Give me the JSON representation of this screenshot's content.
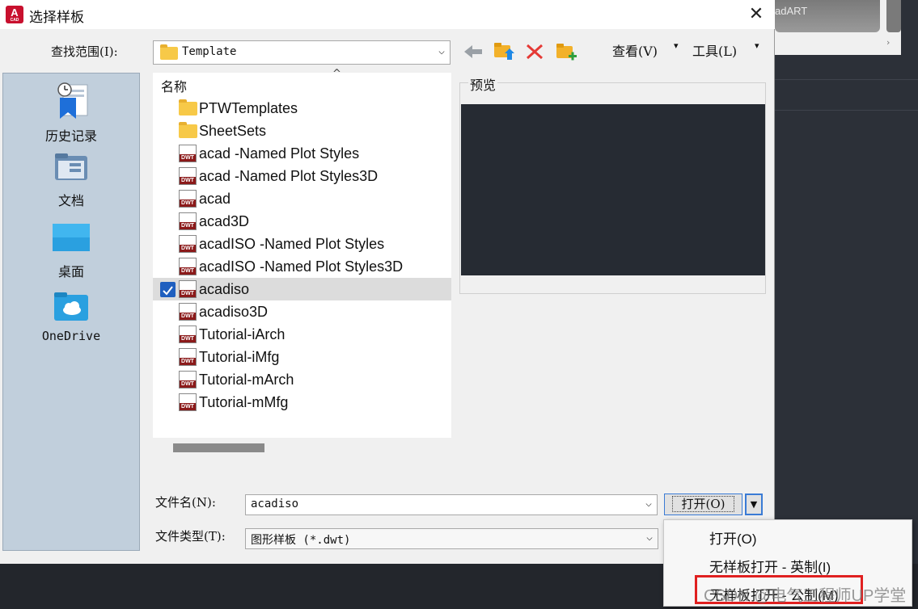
{
  "background": {
    "thumb_label": "adART",
    "chevron": "›"
  },
  "dialog": {
    "title": "选择样板",
    "close_glyph": "✕",
    "app_icon_letter": "A",
    "app_icon_sub": "CAD"
  },
  "toolbar": {
    "lookin_label": "查找范围(I):",
    "lookin_value": "Template",
    "views_label": "查看(V)",
    "tools_label": "工具(L)",
    "dropdown_glyph": "▾"
  },
  "places": [
    {
      "label": "历史记录",
      "icon": "history-icon"
    },
    {
      "label": "文档",
      "icon": "documents-icon"
    },
    {
      "label": "桌面",
      "icon": "desktop-icon"
    },
    {
      "label": "OneDrive",
      "icon": "onedrive-icon"
    }
  ],
  "filelist": {
    "column_header": "名称",
    "sort_glyph": "^",
    "items": [
      {
        "name": "PTWTemplates",
        "type": "folder"
      },
      {
        "name": "SheetSets",
        "type": "folder"
      },
      {
        "name": "acad -Named Plot Styles",
        "type": "dwt"
      },
      {
        "name": "acad -Named Plot Styles3D",
        "type": "dwt"
      },
      {
        "name": "acad",
        "type": "dwt"
      },
      {
        "name": "acad3D",
        "type": "dwt"
      },
      {
        "name": "acadISO -Named Plot Styles",
        "type": "dwt"
      },
      {
        "name": "acadISO -Named Plot Styles3D",
        "type": "dwt"
      },
      {
        "name": "acadiso",
        "type": "dwt",
        "selected": true
      },
      {
        "name": "acadiso3D",
        "type": "dwt"
      },
      {
        "name": "Tutorial-iArch",
        "type": "dwt"
      },
      {
        "name": "Tutorial-iMfg",
        "type": "dwt"
      },
      {
        "name": "Tutorial-mArch",
        "type": "dwt"
      },
      {
        "name": "Tutorial-mMfg",
        "type": "dwt"
      }
    ],
    "dwt_badge": "DWT"
  },
  "preview": {
    "label": "预览"
  },
  "bottom": {
    "filename_label": "文件名(N):",
    "filename_value": "acadiso",
    "filetype_label": "文件类型(T):",
    "filetype_value": "图形样板 (*.dwt)",
    "open_label": "打开(O)",
    "combo_arrow": "⌵",
    "split_glyph": "▼"
  },
  "open_menu": {
    "items": [
      "打开(O)",
      "无样板打开 - 英制(I)",
      "无样板打开 - 公制(M)"
    ]
  },
  "watermark": "CSDN @电气工程师UP学堂",
  "colors": {
    "accent": "#3a7bd5",
    "highlight": "#e02020",
    "places_bg": "#c1cfdc",
    "dwt_red": "#8b1a1a"
  }
}
